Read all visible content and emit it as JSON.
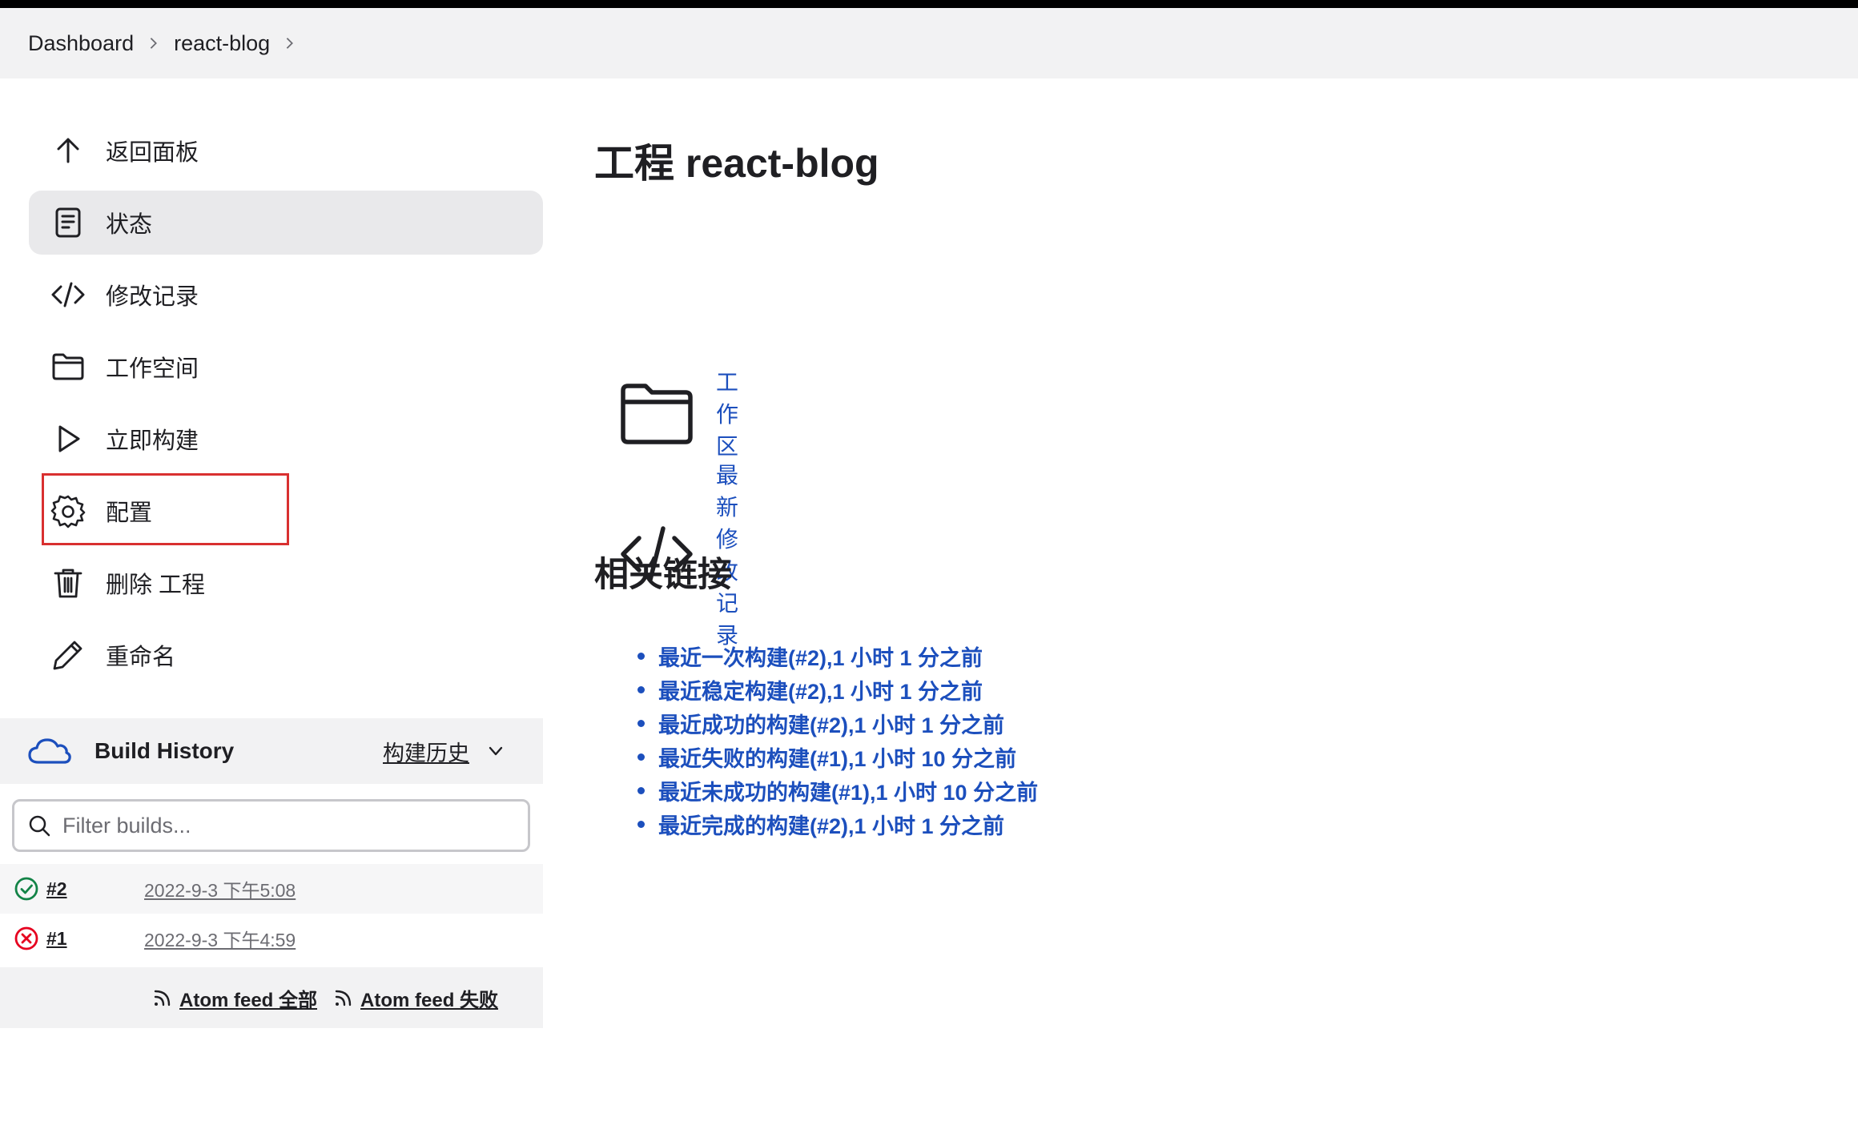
{
  "breadcrumb": [
    {
      "label": "Dashboard"
    },
    {
      "label": "react-blog"
    }
  ],
  "sidebar": {
    "items": [
      {
        "label": "返回面板",
        "icon": "arrow-up-icon"
      },
      {
        "label": "状态",
        "icon": "document-icon",
        "active": true
      },
      {
        "label": "修改记录",
        "icon": "code-icon"
      },
      {
        "label": "工作空间",
        "icon": "folder-icon"
      },
      {
        "label": "立即构建",
        "icon": "play-icon"
      },
      {
        "label": "配置",
        "icon": "gear-icon",
        "highlighted": true
      },
      {
        "label": "删除 工程",
        "icon": "trash-icon"
      },
      {
        "label": "重命名",
        "icon": "pencil-icon"
      }
    ]
  },
  "build_history": {
    "title": "Build History",
    "trend_label": "构建历史",
    "filter_placeholder": "Filter builds...",
    "builds": [
      {
        "number": "#2",
        "time": "2022-9-3 下午5:08",
        "status": "success"
      },
      {
        "number": "#1",
        "time": "2022-9-3 下午4:59",
        "status": "failure"
      }
    ],
    "feeds": [
      {
        "label": "Atom feed 全部"
      },
      {
        "label": "Atom feed 失败"
      }
    ]
  },
  "main": {
    "title": "工程 react-blog",
    "workspace_link": "工作区",
    "changes_link": "最新修改记录",
    "related_title": "相关链接",
    "permalinks": [
      "最近一次构建(#2),1 小时 1 分之前",
      "最近稳定构建(#2),1 小时 1 分之前",
      "最近成功的构建(#2),1 小时 1 分之前",
      "最近失败的构建(#1),1 小时 10 分之前",
      "最近未成功的构建(#1),1 小时 10 分之前",
      "最近完成的构建(#2),1 小时 1 分之前"
    ]
  },
  "colors": {
    "link": "#1c4fbd",
    "highlight_border": "#d93030",
    "success": "#138347",
    "failure": "#e6001f"
  }
}
